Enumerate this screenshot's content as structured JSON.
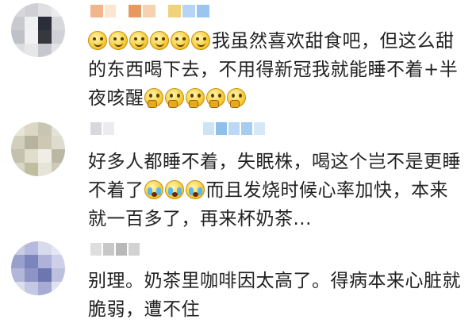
{
  "comments": [
    {
      "avatar_icon": "blurred-avatar-icon",
      "text_before": "我虽然喜欢甜食吧，但这么甜的东西喝下去，不用得新冠我就能睡不着+半夜咳醒",
      "lead_emoji": "smile",
      "lead_count": 6,
      "trail_emoji": "think",
      "trail_count": 5
    },
    {
      "avatar_icon": "blurred-avatar-icon",
      "text_a": "好多人都睡不着，失眠株，喝这个岂不是更睡不着了",
      "mid_emoji": "cry",
      "mid_count": 3,
      "text_b": "而且发烧时候心率加快，本来就一百多了，再来杯奶茶..."
    },
    {
      "avatar_icon": "blurred-avatar-icon",
      "text": "别理。奶茶里咖啡因太高了。得病本来心脏就脆弱，遭不住"
    }
  ]
}
